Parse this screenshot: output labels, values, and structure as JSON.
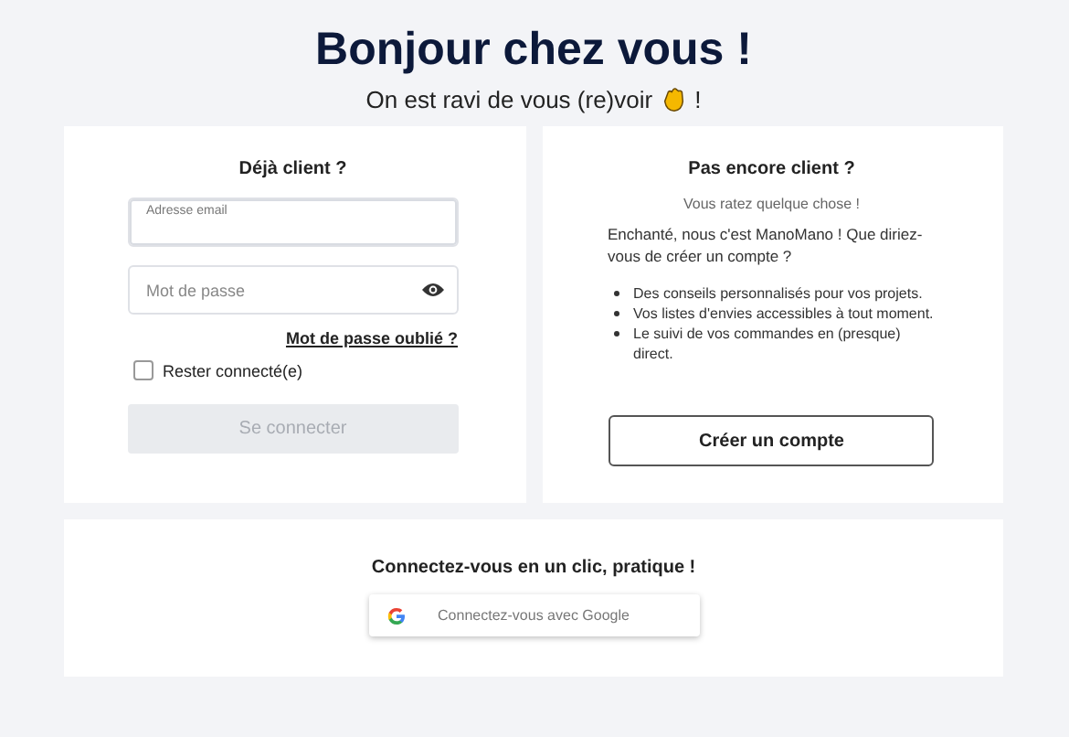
{
  "header": {
    "title": "Bonjour chez vous !",
    "subtitle": "On est ravi de vous (re)voir",
    "subtitle_end": "!"
  },
  "login": {
    "heading": "Déjà client ?",
    "email_field": {
      "label": "Adresse email"
    },
    "password_field": {
      "placeholder": "Mot de passe"
    },
    "forgot_link": "Mot de passe oublié ?",
    "remember": {
      "label": "Rester connecté(e)",
      "checked": false
    },
    "submit": {
      "label": "Se connecter",
      "disabled": true
    }
  },
  "signup": {
    "heading": "Pas encore client ?",
    "tagline": "Vous ratez quelque chose !",
    "intro": "Enchanté, nous c'est ManoMano ! Que diriez-vous de créer un compte ?",
    "benefits": [
      "Des conseils personnalisés pour vos projets.",
      "Vos listes d'envies accessibles à tout moment.",
      "Le suivi de vos commandes en (presque) direct."
    ],
    "button": "Créer un compte"
  },
  "social": {
    "heading": "Connectez-vous en un clic, pratique !",
    "google_button": "Connectez-vous avec Google"
  }
}
